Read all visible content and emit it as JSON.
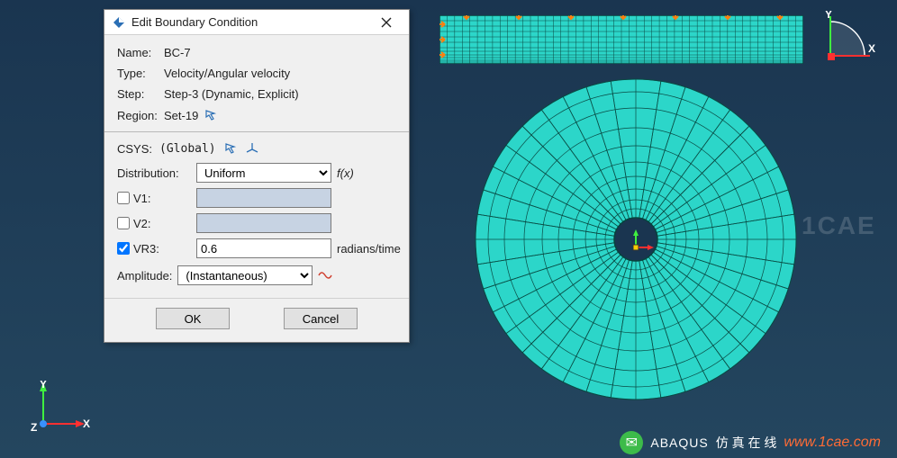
{
  "dialog": {
    "title": "Edit Boundary Condition",
    "name_label": "Name:",
    "name": "BC-7",
    "type_label": "Type:",
    "type": "Velocity/Angular velocity",
    "step_label": "Step:",
    "step": "Step-3 (Dynamic, Explicit)",
    "region_label": "Region:",
    "region": "Set-19",
    "csys_label": "CSYS:",
    "csys": "(Global)",
    "distribution_label": "Distribution:",
    "distribution": "Uniform",
    "fx": "f(x)",
    "v1_label": "V1:",
    "v2_label": "V2:",
    "vr3_label": "VR3:",
    "v1": "",
    "v2": "",
    "vr3": "0.6",
    "vr3_unit": "radians/time",
    "amplitude_label": "Amplitude:",
    "amplitude": "(Instantaneous)",
    "ok": "OK",
    "cancel": "Cancel"
  },
  "axes": {
    "x": "X",
    "y": "Y",
    "z": "Z"
  },
  "watermark": "1CAE",
  "footer": {
    "brand": "ABAQUS",
    "tag": "仿 真 在 线",
    "url": "www.1cae.com"
  }
}
